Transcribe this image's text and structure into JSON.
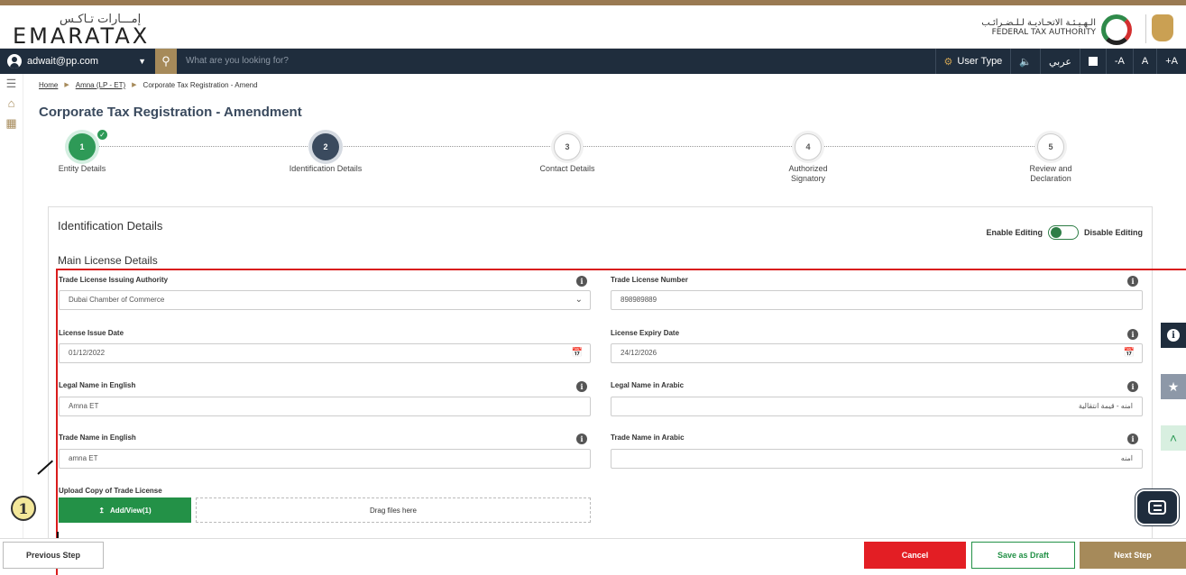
{
  "header": {
    "logo_ar": "إمـــارات تـاكـس",
    "logo_en": "EMARATAX",
    "authority_ar": "الـهـيـئـة الاتحـاديـة لـلـضـرائـب",
    "authority_en": "FEDERAL TAX AUTHORITY"
  },
  "navbar": {
    "user_email": "adwait@pp.com",
    "search_placeholder": "What are you looking for?",
    "user_type": "User Type",
    "arabic": "عربي",
    "font_decrease": "-A",
    "font_normal": "A",
    "font_increase": "+A"
  },
  "breadcrumb": [
    "Home",
    "Amna (LP - ET)",
    "Corporate Tax Registration - Amend"
  ],
  "page_title": "Corporate Tax Registration - Amendment",
  "steps": [
    {
      "num": "1",
      "label": "Entity Details",
      "state": "done"
    },
    {
      "num": "2",
      "label": "Identification Details",
      "state": "active"
    },
    {
      "num": "3",
      "label": "Contact Details",
      "state": "todo"
    },
    {
      "num": "4",
      "label": "Authorized Signatory",
      "state": "todo"
    },
    {
      "num": "5",
      "label": "Review and Declaration",
      "state": "todo"
    }
  ],
  "section": {
    "title": "Identification Details",
    "subtitle": "Main License Details",
    "enable_editing": "Enable Editing",
    "disable_editing": "Disable Editing"
  },
  "fields": {
    "issuing_authority": {
      "label": "Trade License Issuing Authority",
      "value": "Dubai Chamber of Commerce"
    },
    "license_number": {
      "label": "Trade License Number",
      "value": "898989889"
    },
    "issue_date": {
      "label": "License Issue Date",
      "value": "01/12/2022"
    },
    "expiry_date": {
      "label": "License Expiry Date",
      "value": "24/12/2026"
    },
    "legal_name_en": {
      "label": "Legal Name in English",
      "value": "Amna ET"
    },
    "legal_name_ar": {
      "label": "Legal Name in Arabic",
      "value": "امنه - قيمة انتقالية"
    },
    "trade_name_en": {
      "label": "Trade Name in English",
      "value": "amna ET"
    },
    "trade_name_ar": {
      "label": "Trade Name in Arabic",
      "value": "امنه"
    }
  },
  "upload": {
    "label": "Upload Copy of Trade License",
    "button": "Add/View(1)",
    "dropzone": "Drag files here"
  },
  "annotation": {
    "marker": "1"
  },
  "footer": {
    "previous": "Previous Step",
    "cancel": "Cancel",
    "draft": "Save as Draft",
    "next": "Next Step"
  },
  "colors": {
    "primary_dark": "#1f2d3d",
    "gold": "#a68a5a",
    "green": "#239147",
    "red": "#e31e24",
    "annotation_red": "#d91c1c"
  },
  "icons": {
    "info": "info-icon",
    "favorite": "star-icon",
    "scroll_top": "double-chevron-up-icon",
    "chat": "chat-icon"
  }
}
